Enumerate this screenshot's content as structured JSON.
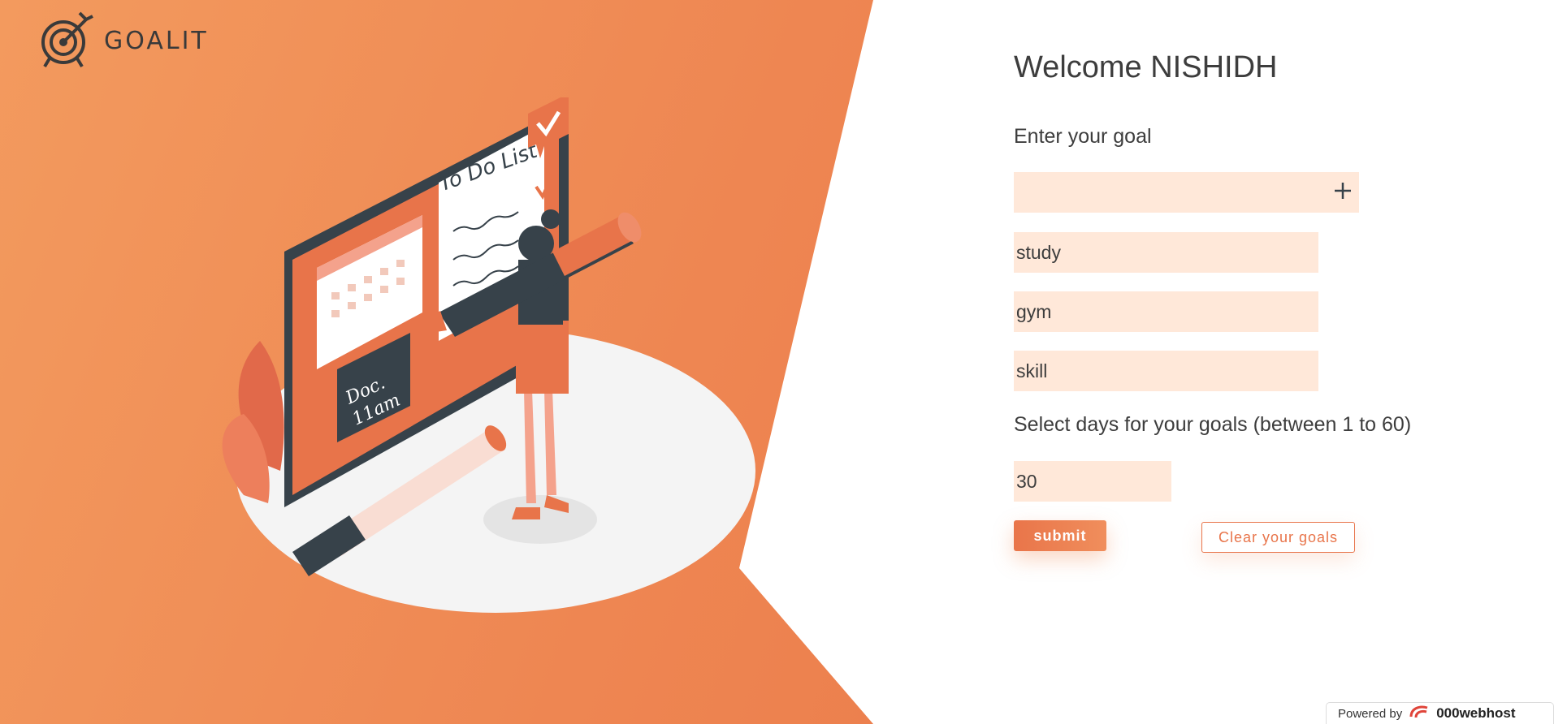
{
  "app": {
    "name": "GOALIT"
  },
  "welcome": "Welcome NISHIDH",
  "goal_label": "Enter your goal",
  "goal_input": {
    "value": "",
    "placeholder": ""
  },
  "goals": [
    "study",
    "gym",
    "skill"
  ],
  "days_label": "Select days for your goals (between 1 to 60)",
  "days_value": "30",
  "submit_label": "submit",
  "clear_label": "Clear your goals",
  "illustration": {
    "todo_title": "To Do List",
    "note_line1": "Doc.",
    "note_line2": "11am"
  },
  "footer": {
    "powered_by": "Powered by",
    "host": "000webhost"
  },
  "colors": {
    "accent": "#e8744a",
    "field_bg": "#ffe8d9",
    "dark": "#37424a"
  }
}
